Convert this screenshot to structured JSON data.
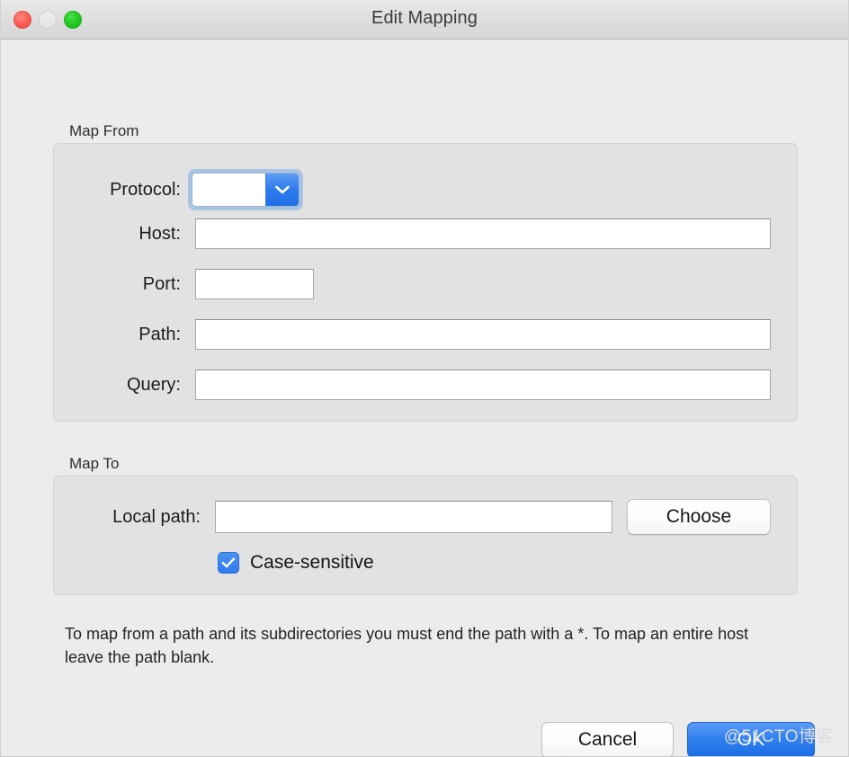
{
  "window": {
    "title": "Edit Mapping",
    "traffic_lights": [
      {
        "name": "close",
        "color": "#fc5a51",
        "enabled": true
      },
      {
        "name": "minimize",
        "color": "#e6e6e6",
        "enabled": false
      },
      {
        "name": "maximize",
        "color": "#1dc81d",
        "enabled": true
      }
    ]
  },
  "map_from": {
    "group_label": "Map From",
    "protocol": {
      "label": "Protocol:",
      "value": "",
      "placeholder": "",
      "focused": true,
      "arrow_icon": "chevron-down-icon"
    },
    "host": {
      "label": "Host:",
      "value": "",
      "placeholder": ""
    },
    "port": {
      "label": "Port:",
      "value": "",
      "placeholder": ""
    },
    "path": {
      "label": "Path:",
      "value": "",
      "placeholder": ""
    },
    "query": {
      "label": "Query:",
      "value": "",
      "placeholder": ""
    }
  },
  "map_to": {
    "group_label": "Map To",
    "local_path": {
      "label": "Local path:",
      "value": "",
      "placeholder": ""
    },
    "choose_label": "Choose",
    "case_sensitive": {
      "label": "Case-sensitive",
      "checked": true,
      "check_icon": "checkmark-icon"
    }
  },
  "help_text": "To map from a path and its subdirectories you must end the path with a *. To map an entire host leave the path blank.",
  "actions": {
    "cancel_label": "Cancel",
    "ok_label": "OK",
    "ok_accent_color": "#3281f0"
  },
  "watermark": "@51CTO博客"
}
